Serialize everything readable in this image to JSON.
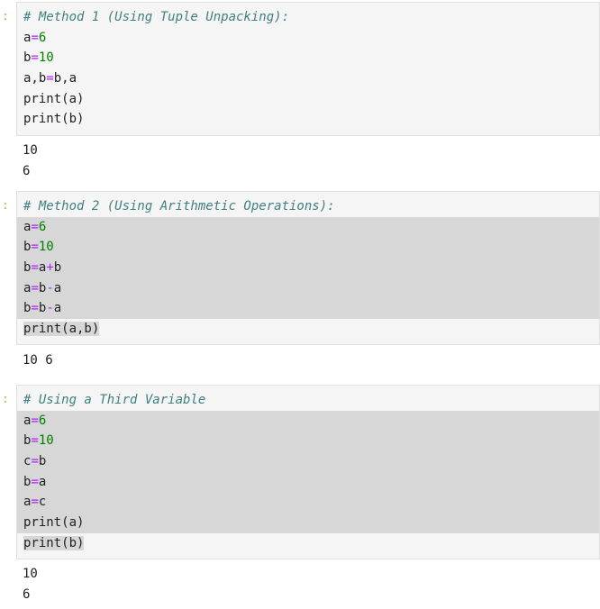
{
  "cells": [
    {
      "prompt": ":",
      "comment": "# Method 1 (Using Tuple Unpacking):",
      "lines": [
        {
          "tokens": [
            [
              "var",
              "a"
            ],
            [
              "op",
              "="
            ],
            [
              "num",
              "6"
            ]
          ]
        },
        {
          "tokens": [
            [
              "var",
              "b"
            ],
            [
              "op",
              "="
            ],
            [
              "num",
              "10"
            ]
          ]
        },
        {
          "tokens": [
            [
              "var",
              "a,b"
            ],
            [
              "op",
              "="
            ],
            [
              "var",
              "b,a"
            ]
          ]
        },
        {
          "tokens": [
            [
              "fn",
              "print(a)"
            ]
          ]
        },
        {
          "tokens": [
            [
              "fn",
              "print(b)"
            ]
          ]
        }
      ],
      "output": [
        "10",
        "6"
      ]
    },
    {
      "prompt": ":",
      "comment": "# Method 2 (Using Arithmetic Operations):",
      "lines": [
        {
          "tokens": [
            [
              "var",
              "a"
            ],
            [
              "op",
              "="
            ],
            [
              "num",
              "6"
            ]
          ]
        },
        {
          "tokens": [
            [
              "var",
              "b"
            ],
            [
              "op",
              "="
            ],
            [
              "num",
              "10"
            ]
          ]
        },
        {
          "tokens": [
            [
              "var",
              "b"
            ],
            [
              "op",
              "="
            ],
            [
              "var",
              "a"
            ],
            [
              "op",
              "+"
            ],
            [
              "var",
              "b"
            ]
          ]
        },
        {
          "tokens": [
            [
              "var",
              "a"
            ],
            [
              "op",
              "="
            ],
            [
              "var",
              "b"
            ],
            [
              "op",
              "-"
            ],
            [
              "var",
              "a"
            ]
          ]
        },
        {
          "tokens": [
            [
              "var",
              "b"
            ],
            [
              "op",
              "="
            ],
            [
              "var",
              "b"
            ],
            [
              "op",
              "-"
            ],
            [
              "var",
              "a"
            ]
          ]
        },
        {
          "tokens": [
            [
              "fn",
              "print(a,b)"
            ]
          ]
        }
      ],
      "output": [
        "10 6"
      ]
    },
    {
      "prompt": ":",
      "comment": "# Using a Third Variable",
      "lines": [
        {
          "tokens": [
            [
              "var",
              "a"
            ],
            [
              "op",
              "="
            ],
            [
              "num",
              "6"
            ]
          ]
        },
        {
          "tokens": [
            [
              "var",
              "b"
            ],
            [
              "op",
              "="
            ],
            [
              "num",
              "10"
            ]
          ]
        },
        {
          "tokens": [
            [
              "var",
              "c"
            ],
            [
              "op",
              "="
            ],
            [
              "var",
              "b"
            ]
          ]
        },
        {
          "tokens": [
            [
              "var",
              "b"
            ],
            [
              "op",
              "="
            ],
            [
              "var",
              "a"
            ]
          ]
        },
        {
          "tokens": [
            [
              "var",
              "a"
            ],
            [
              "op",
              "="
            ],
            [
              "var",
              "c"
            ]
          ]
        },
        {
          "tokens": [
            [
              "fn",
              "print(a)"
            ]
          ]
        },
        {
          "tokens": [
            [
              "fn",
              "print(b)"
            ]
          ]
        }
      ],
      "output": [
        "10",
        "6"
      ]
    }
  ]
}
